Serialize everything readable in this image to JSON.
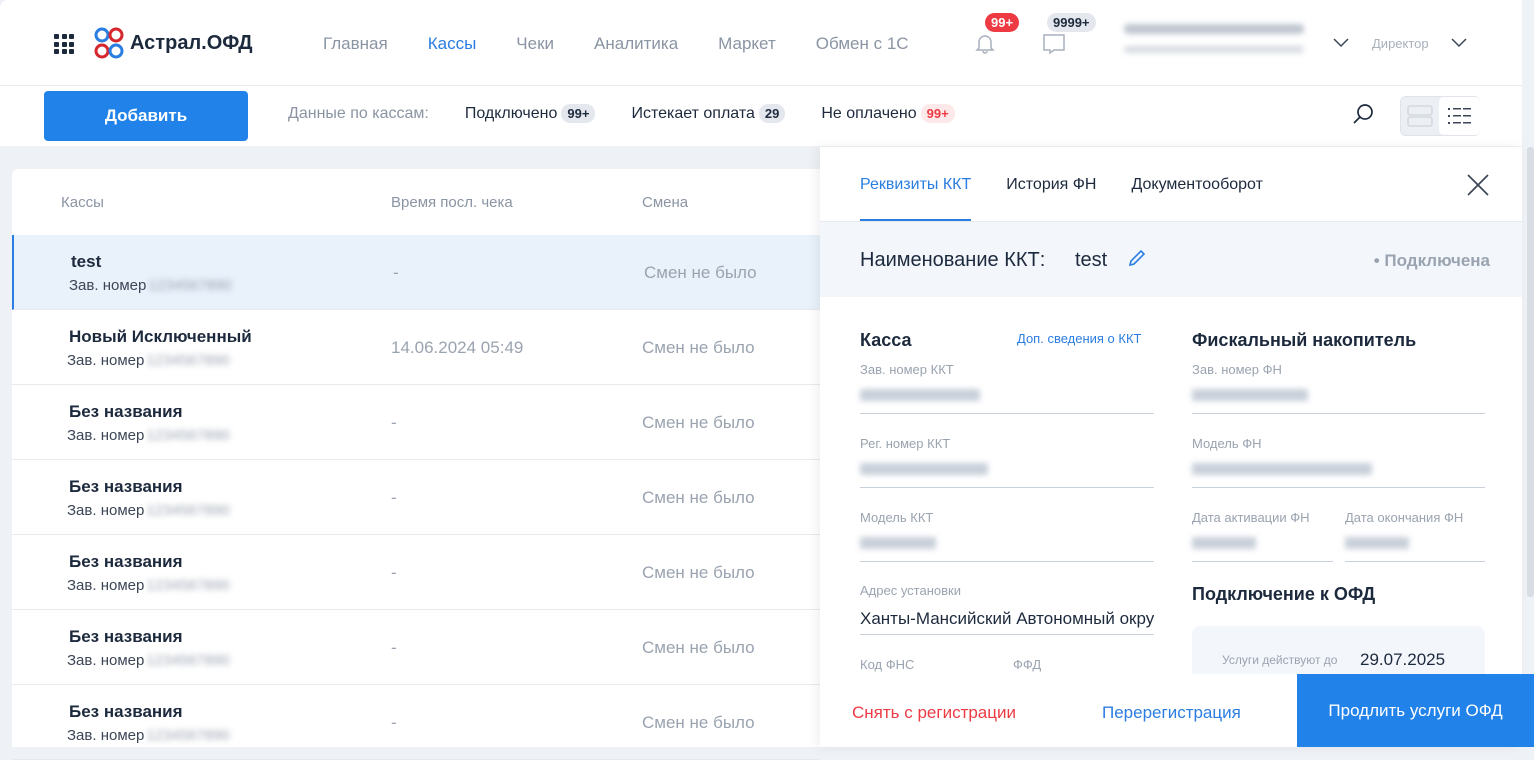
{
  "header": {
    "brand": "Астрал.ОФД",
    "nav": [
      "Главная",
      "Кассы",
      "Чеки",
      "Аналитика",
      "Маркет",
      "Обмен с 1С"
    ],
    "notifications_badge": "99+",
    "messages_badge": "9999+",
    "role": "Директор"
  },
  "toolbar": {
    "add_label": "Добавить",
    "stats_label": "Данные по кассам:",
    "stats": [
      {
        "label": "Подключено",
        "count": "99+"
      },
      {
        "label": "Истекает оплата",
        "count": "29"
      },
      {
        "label": "Не оплачено",
        "count": "99+"
      }
    ]
  },
  "table": {
    "columns": [
      "Кассы",
      "Время посл. чека",
      "Смена"
    ],
    "serial_label": "Зав. номер",
    "rows": [
      {
        "name": "test",
        "time": "-",
        "shift": "Смен не было"
      },
      {
        "name": "Новый Исключенный",
        "time": "14.06.2024 05:49",
        "shift": "Смен не было"
      },
      {
        "name": "Без названия",
        "time": "-",
        "shift": "Смен не было"
      },
      {
        "name": "Без названия",
        "time": "-",
        "shift": "Смен не было"
      },
      {
        "name": "Без названия",
        "time": "-",
        "shift": "Смен не было"
      },
      {
        "name": "Без названия",
        "time": "-",
        "shift": "Смен не было"
      },
      {
        "name": "Без названия",
        "time": "-",
        "shift": "Смен не было"
      }
    ]
  },
  "panel": {
    "tabs": [
      "Реквизиты ККТ",
      "История ФН",
      "Документооборот"
    ],
    "name_label": "Наименование ККТ:",
    "name_value": "test",
    "status": "• Подключена",
    "kassa": {
      "title": "Касса",
      "link": "Доп. сведения о ККТ",
      "serial_label": "Зав. номер ККТ",
      "reg_label": "Рег. номер ККТ",
      "model_label": "Модель ККТ",
      "address_label": "Адрес установки",
      "address_value": "Ханты-Мансийский Автономный округ",
      "fns_label": "Код ФНС",
      "ffd_label": "ФФД"
    },
    "fn": {
      "title": "Фискальный накопитель",
      "serial_label": "Зав. номер ФН",
      "model_label": "Модель ФН",
      "activation_label": "Дата активации ФН",
      "end_label": "Дата окончания ФН"
    },
    "ofd": {
      "title": "Подключение к ОФД",
      "services_label": "Услуги действуют до",
      "services_date": "29.07.2025"
    },
    "footer": {
      "deregister": "Снять с регистрации",
      "reregister": "Перерегистрация",
      "extend": "Продлить услуги ОФД"
    }
  }
}
